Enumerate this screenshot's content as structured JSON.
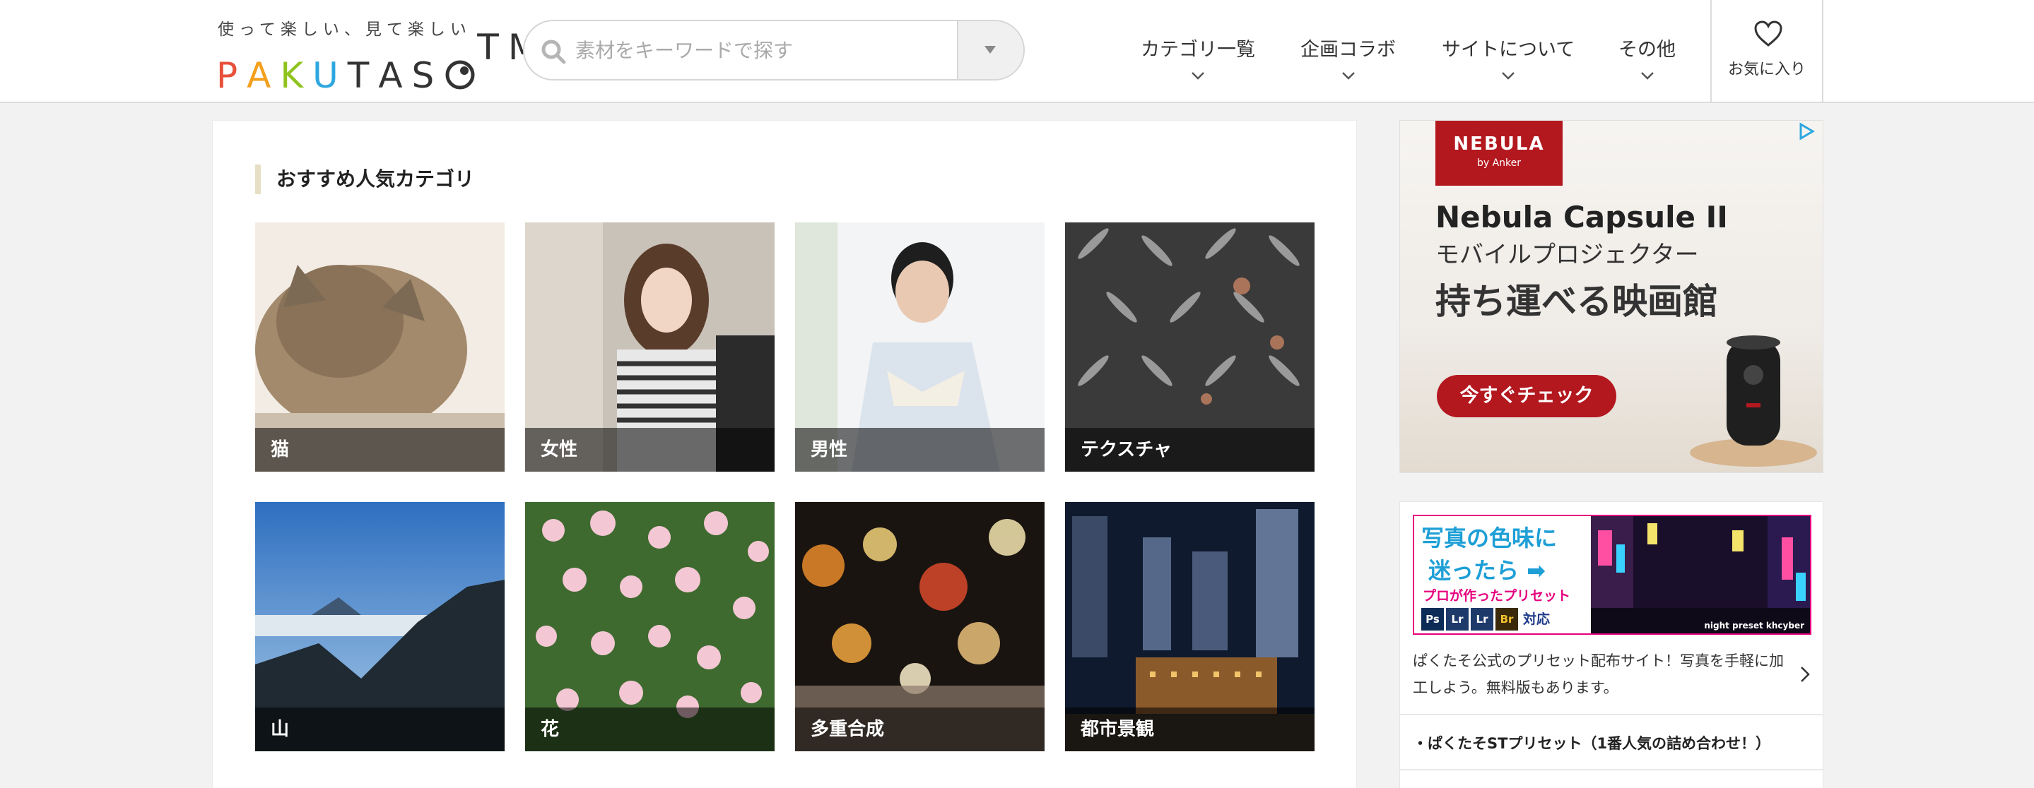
{
  "header": {
    "tagline": "使って楽しい、見て楽しい",
    "brand": "PAKUTASO",
    "search_placeholder": "素材をキーワードで探す",
    "nav": [
      {
        "label": "カテゴリ一覧"
      },
      {
        "label": "企画コラボ"
      },
      {
        "label": "サイトについて"
      },
      {
        "label": "その他"
      }
    ],
    "favorites_label": "お気に入り"
  },
  "main": {
    "section_title": "おすすめ人気カテゴリ",
    "categories": [
      {
        "label": "猫"
      },
      {
        "label": "女性"
      },
      {
        "label": "男性"
      },
      {
        "label": "テクスチャ"
      },
      {
        "label": "山"
      },
      {
        "label": "花"
      },
      {
        "label": "多重合成"
      },
      {
        "label": "都市景観"
      }
    ]
  },
  "sidebar": {
    "ad": {
      "brand": "NEBULA",
      "brand_sub": "by Anker",
      "headline": "Nebula Capsule II",
      "subhead": "モバイルプロジェクター",
      "tagline": "持ち運べる映画館",
      "cta": "今すぐチェック"
    },
    "preset": {
      "banner_line1": "写真の色味に",
      "banner_line2": "迷ったら ➡",
      "banner_line3": "プロが作ったプリセット",
      "apps": [
        "Ps",
        "Lr",
        "Lr",
        "Br"
      ],
      "taiou": "対応",
      "banner_caption": "night preset khcyber",
      "description": "ぱくたそ公式のプリセット配布サイト！写真を手軽に加工しよう。無料版もあります。",
      "link1": "・ぱくたそSTプリセット（1番人気の詰め合わせ！）"
    }
  },
  "colors": {
    "accent_red": "#b3181f",
    "banner_blue": "#1e9fd6",
    "banner_pink": "#e5007f"
  }
}
